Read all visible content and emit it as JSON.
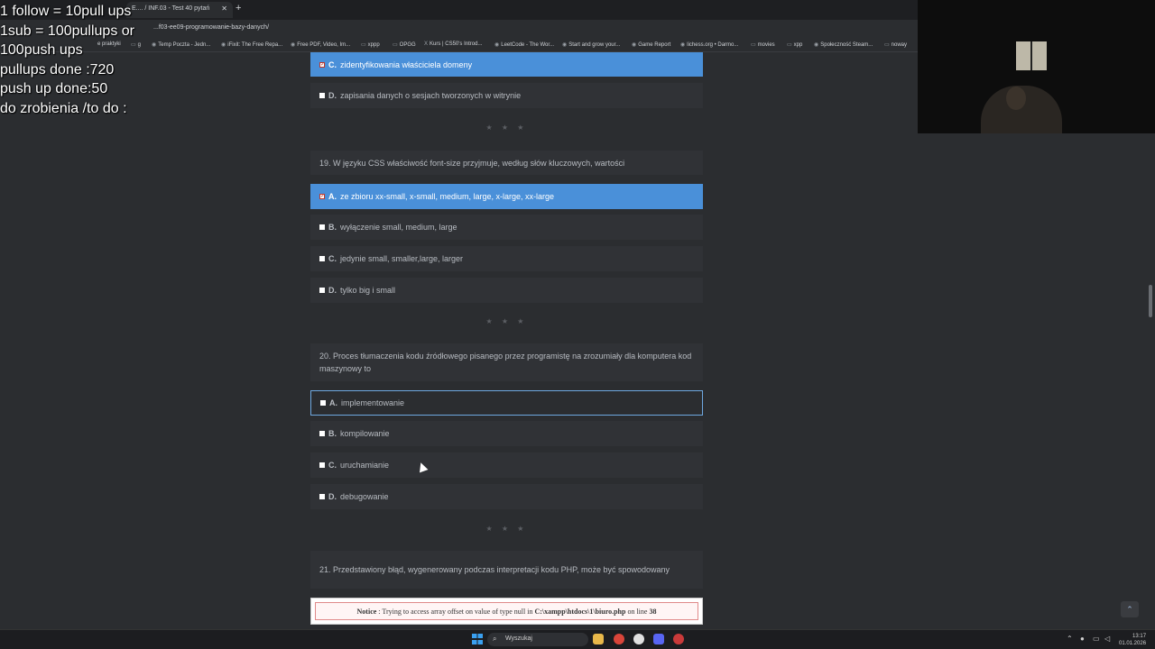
{
  "browser": {
    "tab_title": "E.... / INF.03 - Test 40 pytań",
    "url": "...f03-ee09-programowanie-bazy-danych/",
    "bookmarks": [
      "e praktyki",
      "g",
      "Temp Poczta - Jedn...",
      "iFixit: The Free Repa...",
      "Free PDF, Video, Im...",
      "xppp",
      "OPGG",
      "Kurs | CS50's Introd...",
      "LeetCode - The Wor...",
      "Start and grow your...",
      "Game Report",
      "lichess.org • Darmo...",
      "movies",
      "xpp",
      "Społeczność Steam...",
      "noway"
    ]
  },
  "overlay": {
    "lines": [
      "1 follow = 10pull ups",
      "1sub = 100pullups or",
      "100push ups",
      "pullups done :720",
      "push up done:50",
      "do zrobienia /to do :"
    ]
  },
  "quiz": {
    "prev_options": [
      {
        "letter": "C.",
        "text": "zidentyfikowania właściciela domeny",
        "selected": true
      },
      {
        "letter": "D.",
        "text": "zapisania danych o sesjach tworzonych w witrynie",
        "selected": false
      }
    ],
    "separator": "★ ★ ★",
    "q19": {
      "question": "19. W języku CSS właściwość font-size przyjmuje, według słów kluczowych, wartości",
      "options": [
        {
          "letter": "A.",
          "text": "ze zbioru xx-small, x-small, medium, large, x-large, xx-large",
          "selected": true
        },
        {
          "letter": "B.",
          "text": "wyłączenie small, medium, large",
          "selected": false
        },
        {
          "letter": "C.",
          "text": "jedynie small, smaller,large, larger",
          "selected": false
        },
        {
          "letter": "D.",
          "text": "tylko big i small",
          "selected": false
        }
      ]
    },
    "q20": {
      "question": "20. Proces tłumaczenia kodu źródłowego pisanego przez programistę na zrozumiały dla komputera kod maszynowy to",
      "options": [
        {
          "letter": "A.",
          "text": "implementowanie",
          "selected": false
        },
        {
          "letter": "B.",
          "text": "kompilowanie",
          "selected": false
        },
        {
          "letter": "C.",
          "text": "uruchamianie",
          "selected": false
        },
        {
          "letter": "D.",
          "text": "debugowanie",
          "selected": false
        }
      ]
    },
    "q21": {
      "question": "21. Przedstawiony błąd, wygenerowany podczas interpretacji kodu PHP, może być spowodowany",
      "notice_label": "Notice",
      "notice_text": ": Trying to access array offset on value of type null in",
      "notice_path": "C:\\xampp\\htdocs\\1\\biuro.php",
      "notice_on": "on line",
      "notice_line": "38"
    }
  },
  "taskbar": {
    "search_placeholder": "Wyszukaj",
    "time": "13:17",
    "date": "01.01.2026"
  }
}
